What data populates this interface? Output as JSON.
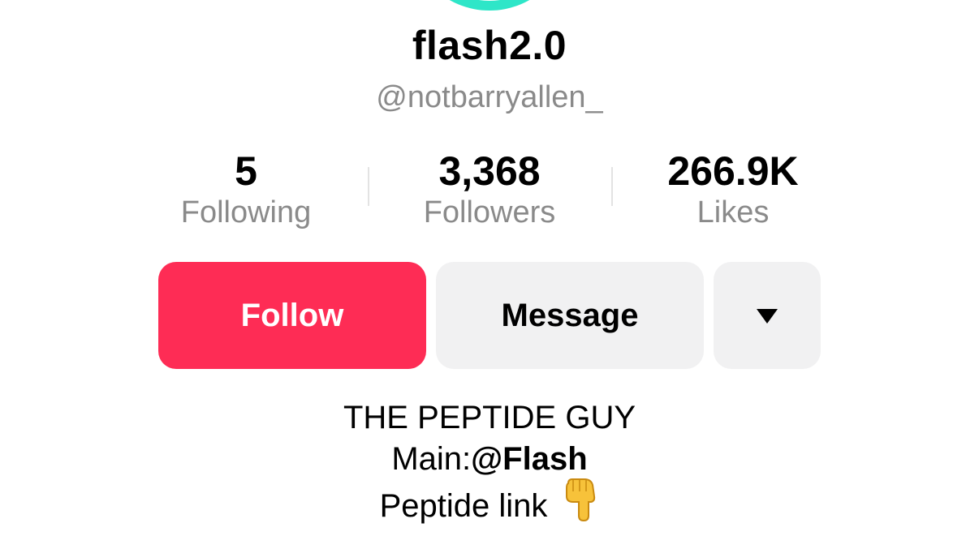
{
  "profile": {
    "display_name": "flash2.0",
    "username": "@notbarryallen_"
  },
  "stats": [
    {
      "value": "5",
      "label": "Following"
    },
    {
      "value": "3,368",
      "label": "Followers"
    },
    {
      "value": "266.9K",
      "label": "Likes"
    }
  ],
  "actions": {
    "follow_label": "Follow",
    "message_label": "Message",
    "more_icon": "caret-down-icon"
  },
  "bio": {
    "line1": "THE PEPTIDE GUY",
    "line2_prefix": "Main:",
    "line2_mention": "@Flash",
    "line3": "Peptide link",
    "line3_emoji": "pointing-down-hand-icon"
  },
  "colors": {
    "follow_button": "#fe2c55",
    "secondary_button": "#f1f1f2",
    "avatar_ring": "#2ee6c8",
    "muted_text": "#8a8a8a"
  }
}
